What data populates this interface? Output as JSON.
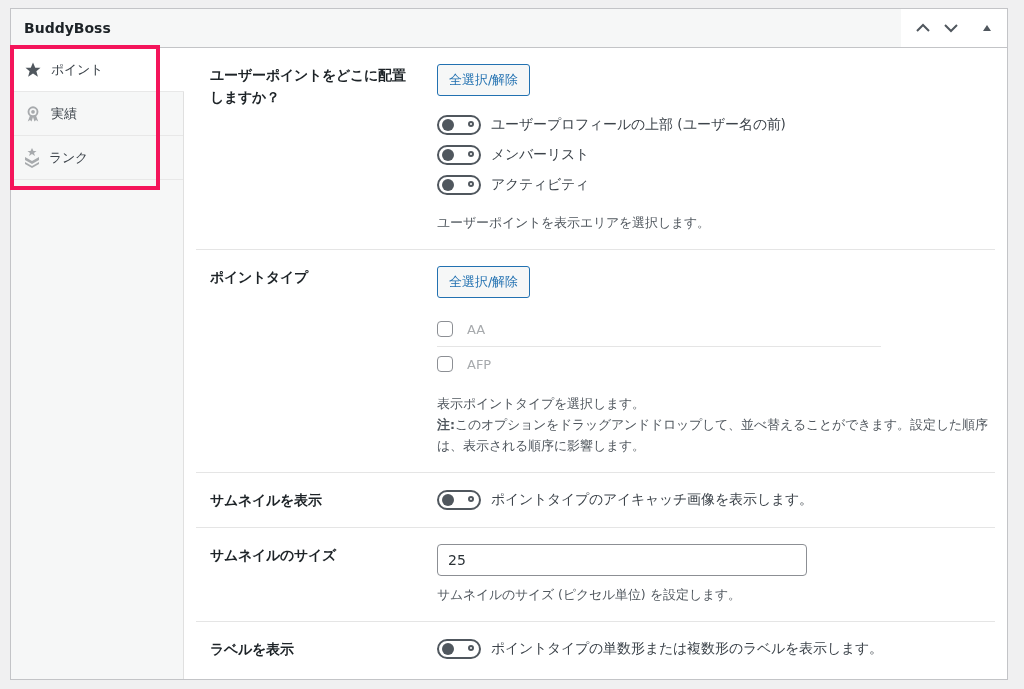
{
  "panel": {
    "title": "BuddyBoss"
  },
  "tabs": [
    {
      "label": "ポイント",
      "selected": true,
      "kind": "star"
    },
    {
      "label": "実績",
      "selected": false,
      "kind": "award"
    },
    {
      "label": "ランク",
      "selected": false,
      "kind": "rank"
    }
  ],
  "highlight": true,
  "settings": [
    {
      "kind": "toggle_group",
      "label": "ユーザーポイントをどこに配置しますか？",
      "button": "全選択/解除",
      "options": [
        {
          "label": "ユーザープロフィールの上部 (ユーザー名の前)",
          "on": false
        },
        {
          "label": "メンバーリスト",
          "on": false
        },
        {
          "label": "アクティビティ",
          "on": false
        }
      ],
      "help": [
        "ユーザーポイントを表示エリアを選択します。"
      ]
    },
    {
      "kind": "checkbox_group",
      "label": "ポイントタイプ",
      "button": "全選択/解除",
      "options": [
        {
          "label": "AA",
          "checked": false
        },
        {
          "label": "AFP",
          "checked": false
        }
      ],
      "help": [
        "表示ポイントタイプを選択します。",
        "**注:**このオプションをドラッグアンドドロップして、並べ替えることができます。設定した順序は、表示される順序に影響します。"
      ]
    },
    {
      "kind": "toggle",
      "label": "サムネイルを表示",
      "on": false,
      "text": "ポイントタイプのアイキャッチ画像を表示します。"
    },
    {
      "kind": "number",
      "label": "サムネイルのサイズ",
      "value": "25",
      "help": [
        "サムネイルのサイズ (ピクセル単位) を設定します。"
      ]
    },
    {
      "kind": "toggle",
      "label": "ラベルを表示",
      "on": false,
      "text": "ポイントタイプの単数形または複数形のラベルを表示します。"
    }
  ]
}
